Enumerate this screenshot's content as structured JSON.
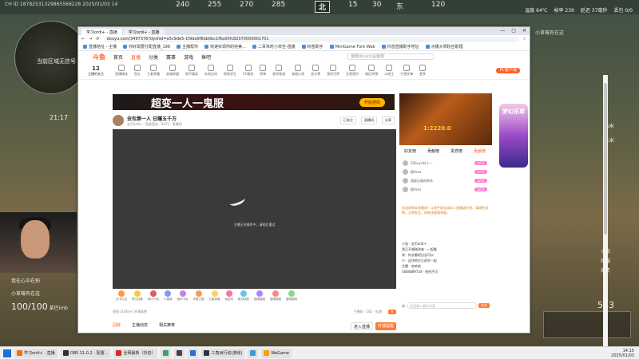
{
  "hud": {
    "overlay_line": "CH ID 18782531329865568228 2025/01/03 14",
    "compass": {
      "left2": "240",
      "n255": "255",
      "n270": "270",
      "n285": "285",
      "n300": "300",
      "n330": "330",
      "main": "北",
      "n15": "15",
      "n30": "30",
      "n45": "45",
      "n60": "60",
      "east": "东",
      "n105": "105",
      "n120": "120",
      "n135": "135"
    },
    "stats": [
      "温度 64℃",
      "帧率 239",
      "延迟 37毫秒",
      "丢包 0/0"
    ],
    "minimap_text": "当前区域无信号",
    "timer": "21:17",
    "feed": "小草莓有在这",
    "right_list": [
      "95米",
      "81米",
      "95米"
    ],
    "side_small": [
      "小张",
      "国服",
      "高贵"
    ],
    "squad": [
      {
        "name": "我在心中在拍",
        "hp": ""
      },
      {
        "name": "小草莓有在这",
        "hp": ""
      },
      {
        "name": "某巴imb",
        "hp": "100/100"
      }
    ],
    "weapon": "523"
  },
  "browser": {
    "tabs": [
      "学习ordi+ - 直播",
      "学习ordi+ - 直播"
    ],
    "window_controls": [
      "—",
      "▢",
      "✕"
    ],
    "url": "douyu.com/3497376?dyshid=a5c9de5-1f9da9f6bb0bc1f6a00fc82070000001701",
    "bookmarks": [
      "直播地址 - 主播",
      "你好需要分配直播_198",
      "主播帮你",
      "快速实现你的完美...",
      "二百米时小米空-直播",
      "标签助手",
      "MiniGame Fork Web",
      "抖音直播助手地址",
      "点播大师粉丝助理"
    ],
    "site": {
      "logo": "斗鱼",
      "nav": [
        "首页",
        "直播",
        "分类",
        "赛事",
        "游戏",
        "鱼吧"
      ],
      "search_placeholder": "鱼眼douyin@鱼眼"
    },
    "follow": {
      "count": "12",
      "label": "主播的关注"
    },
    "categories": [
      "直播精选",
      "鱼丸",
      "王者荣耀",
      "英雄联盟",
      "和平精英",
      "永劫无间",
      "绝地求生",
      "CF端游",
      "原神",
      "星穹铁道",
      "穿越火线",
      "逆水寒",
      "我的世界",
      "无畏契约",
      "暗区突围",
      "斗地主",
      "守望先锋",
      "更多"
    ],
    "pc_btn": "PC客户端",
    "banner": {
      "title": "超变一人一鬼服",
      "btn": "开始游戏"
    },
    "streamer": {
      "title": "去包第一人 日赚五千万",
      "meta": "金币ordi+  ·  网游竞技  ·  5471  ·  直播间",
      "buttons": [
        "已关注",
        "直播间",
        "分享"
      ]
    },
    "player_msg": "主播正在操作中，请稍后重试",
    "gifts": [
      "办卡礼包",
      "罗辽特殊",
      "网人代言",
      "小猫咪",
      "迷你卡包",
      "车票之路",
      "五星房客",
      "动起来",
      "帐对跃跃",
      "猫咪跳跳",
      "猫咪跳跳",
      "猫咪跳跳"
    ],
    "bottom": {
      "left": "举报 [330k+] 开通续费",
      "right": "主播私  ·  182 · 礼物"
    },
    "page_tabs": [
      "回放",
      "主播动态",
      "相关推荐"
    ],
    "page_btns": [
      "进入直播",
      "开播提醒"
    ]
  },
  "chat": {
    "game_number": "1:2220.0",
    "ad_right": "梦幻乐章",
    "tabs": [
      "好友榜",
      "贡献榜",
      "贵宾榜",
      "贡献榜"
    ],
    "rank": [
      {
        "name": "ZSbuyi·斜十一",
        "badge": "LV21"
      },
      {
        "name": "颜ltsas",
        "badge": "LV21"
      },
      {
        "name": "超级无敌的狗系",
        "badge": "LV21"
      },
      {
        "name": "颜ltsas",
        "badge": "LV21"
      }
    ],
    "notice": "欢迎来到本直播间！斗鱼严禁未成年人直播或打赏，请理性消费，文明发言，如有违规请举报。",
    "messages": [
      "小张 · 金币ordi+ ",
      "我又不想刚进来 · 一起看",
      "宋：你去看吧出去可以",
      "小 · 这块地方已退学一起",
      "主播 · 哈哈哈",
      "1684889724 · 哈哈不可"
    ],
    "input_placeholder": "这里输入聊天内容",
    "send": "发送"
  },
  "taskbar": {
    "items": [
      "学习ordi+ - 直播",
      "OBS 31.0.2 - 配置...",
      "全网最新（抖音）",
      "",
      "",
      "",
      "三角洲行动(游戏)",
      "",
      "WeGame"
    ],
    "time": "14:15",
    "date": "2025/01/03"
  }
}
